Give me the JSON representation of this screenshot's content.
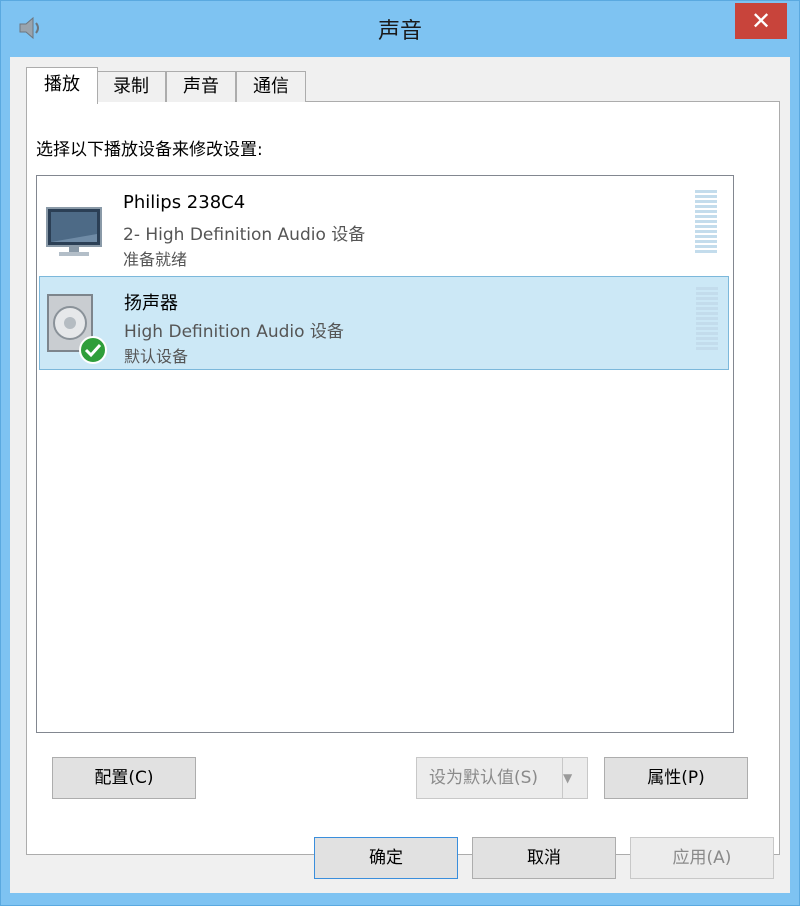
{
  "window": {
    "title": "声音",
    "app_icon": "speaker-icon",
    "close_label": "✕"
  },
  "tabs": [
    {
      "label": "播放",
      "active": true
    },
    {
      "label": "录制",
      "active": false
    },
    {
      "label": "声音",
      "active": false
    },
    {
      "label": "通信",
      "active": false
    }
  ],
  "playback": {
    "instruction": "选择以下播放设备来修改设置:",
    "devices": [
      {
        "name": "Philips 238C4",
        "description": "2- High Definition Audio 设备",
        "status": "准备就绪",
        "icon": "monitor-icon",
        "selected": false
      },
      {
        "name": "扬声器",
        "description": "High Definition Audio 设备",
        "status": "默认设备",
        "icon": "speaker-icon",
        "default_badge": "check-icon",
        "selected": true
      }
    ]
  },
  "buttons": {
    "configure": "配置(C)",
    "set_default": "设为默认值(S)",
    "properties": "属性(P)",
    "ok": "确定",
    "cancel": "取消",
    "apply": "应用(A)"
  },
  "colors": {
    "accent": "#7ec3f2",
    "close": "#c8443b",
    "selected_row": "#cce8f6"
  }
}
